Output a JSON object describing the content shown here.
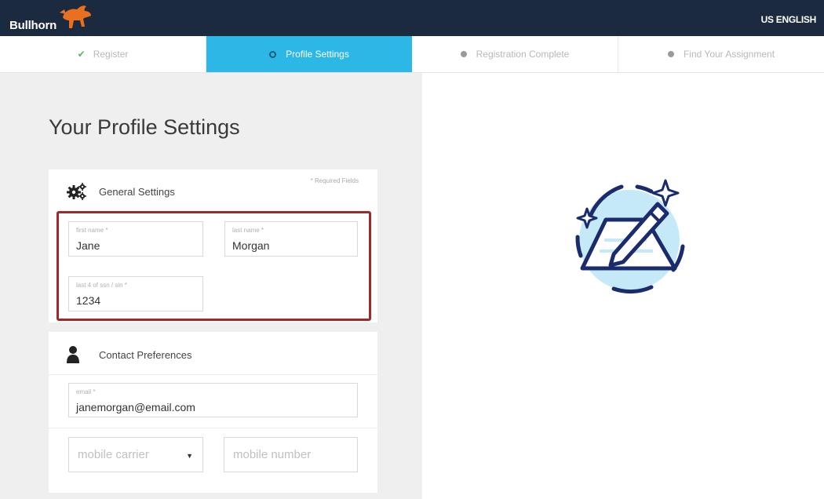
{
  "header": {
    "brand": "Bullhorn",
    "language": "US ENGLISH"
  },
  "steps": [
    {
      "label": "Register",
      "state": "done",
      "icon": "check-icon"
    },
    {
      "label": "Profile Settings",
      "state": "active",
      "icon": "ring-icon"
    },
    {
      "label": "Registration Complete",
      "state": "pending",
      "icon": "dot-icon"
    },
    {
      "label": "Find Your Assignment",
      "state": "pending",
      "icon": "dot-icon"
    }
  ],
  "page": {
    "title": "Your Profile Settings"
  },
  "general": {
    "title": "General Settings",
    "icon": "gears-icon",
    "required_note": "* Required Fields",
    "first_name": {
      "label": "first name *",
      "value": "Jane"
    },
    "last_name": {
      "label": "last name *",
      "value": "Morgan"
    },
    "ssn": {
      "label": "last 4 of ssn / sin *",
      "value": "1234"
    }
  },
  "contact": {
    "title": "Contact Preferences",
    "icon": "person-icon",
    "email": {
      "label": "email *",
      "value": "janemorgan@email.com"
    },
    "mobile_carrier": {
      "placeholder": "mobile carrier"
    },
    "mobile_number": {
      "placeholder": "mobile number"
    }
  },
  "colors": {
    "topbar": "#1c2a3f",
    "active_step": "#2db7e6",
    "highlight": "#9d2a2a",
    "check": "#5cb85c",
    "brand_orange": "#e8701f"
  }
}
